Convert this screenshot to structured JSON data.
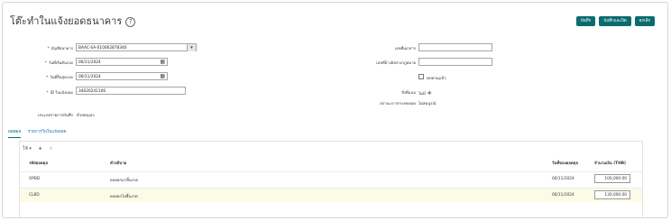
{
  "page": {
    "title": "โต๊ะทำในแจ้งยอดธนาคาร",
    "help_icon": "?"
  },
  "top_buttons": [
    {
      "label": "บันทึก"
    },
    {
      "label": "บันทึกและปิด"
    },
    {
      "label": "ยกเลิก"
    }
  ],
  "form": {
    "bank_account": {
      "label": "บัญชีธนาคาร",
      "value": "BAAC-SA-010062878340"
    },
    "start_date": {
      "label": "วันที่เริ่มต้นงวด",
      "value": "06/11/2024"
    },
    "end_date": {
      "label": "วันที่สิ้นสุดงวด",
      "value": "06/11/2024"
    },
    "statement_id": {
      "label": "ID ใบแจ้งยอด",
      "value": "34020241106"
    },
    "record_type": {
      "label": "ประเภทรายการบันทึก",
      "value": "ด้วยตนเอง"
    },
    "document_number": {
      "label": "เลขที่เอกสาร",
      "value": ""
    },
    "bank_reference": {
      "label": "เลขที่อ้างอิงทางกฎหมาย",
      "value": ""
    },
    "adjusted_label": "ทบทวนแล้ว",
    "attachments": {
      "label": "สิ่งที่แนบ",
      "value": "ไม่มี"
    },
    "recon_status": {
      "label": "สถานะการกระทบยอด",
      "value": "ไม่สมบูรณ์"
    }
  },
  "tabs": [
    {
      "label": "ยอดดุล"
    },
    {
      "label": "รายการในใบแจ้งยอด"
    }
  ],
  "toolbar": {
    "view": "ใช้ ▾",
    "add": "+",
    "remove": "×"
  },
  "table": {
    "headers": [
      "รหัสยอดดุล",
      "คำอธิบาย",
      "วันที่ของยอดดุล",
      "จำนวนเงิน (THB)"
    ],
    "rows": [
      {
        "code": "OPBD",
        "description": "ยอดยกมาสิ้นงวด",
        "date": "06/11/2024",
        "amount": "100,000.00"
      },
      {
        "code": "CLBD",
        "description": "ยอดยกไปสิ้นงวด",
        "date": "06/11/2024",
        "amount": "130,000.00"
      }
    ]
  },
  "colors": {
    "accent": "#0b6b70",
    "link": "#1f6fb4",
    "highlight_row": "#fbfbe6"
  }
}
